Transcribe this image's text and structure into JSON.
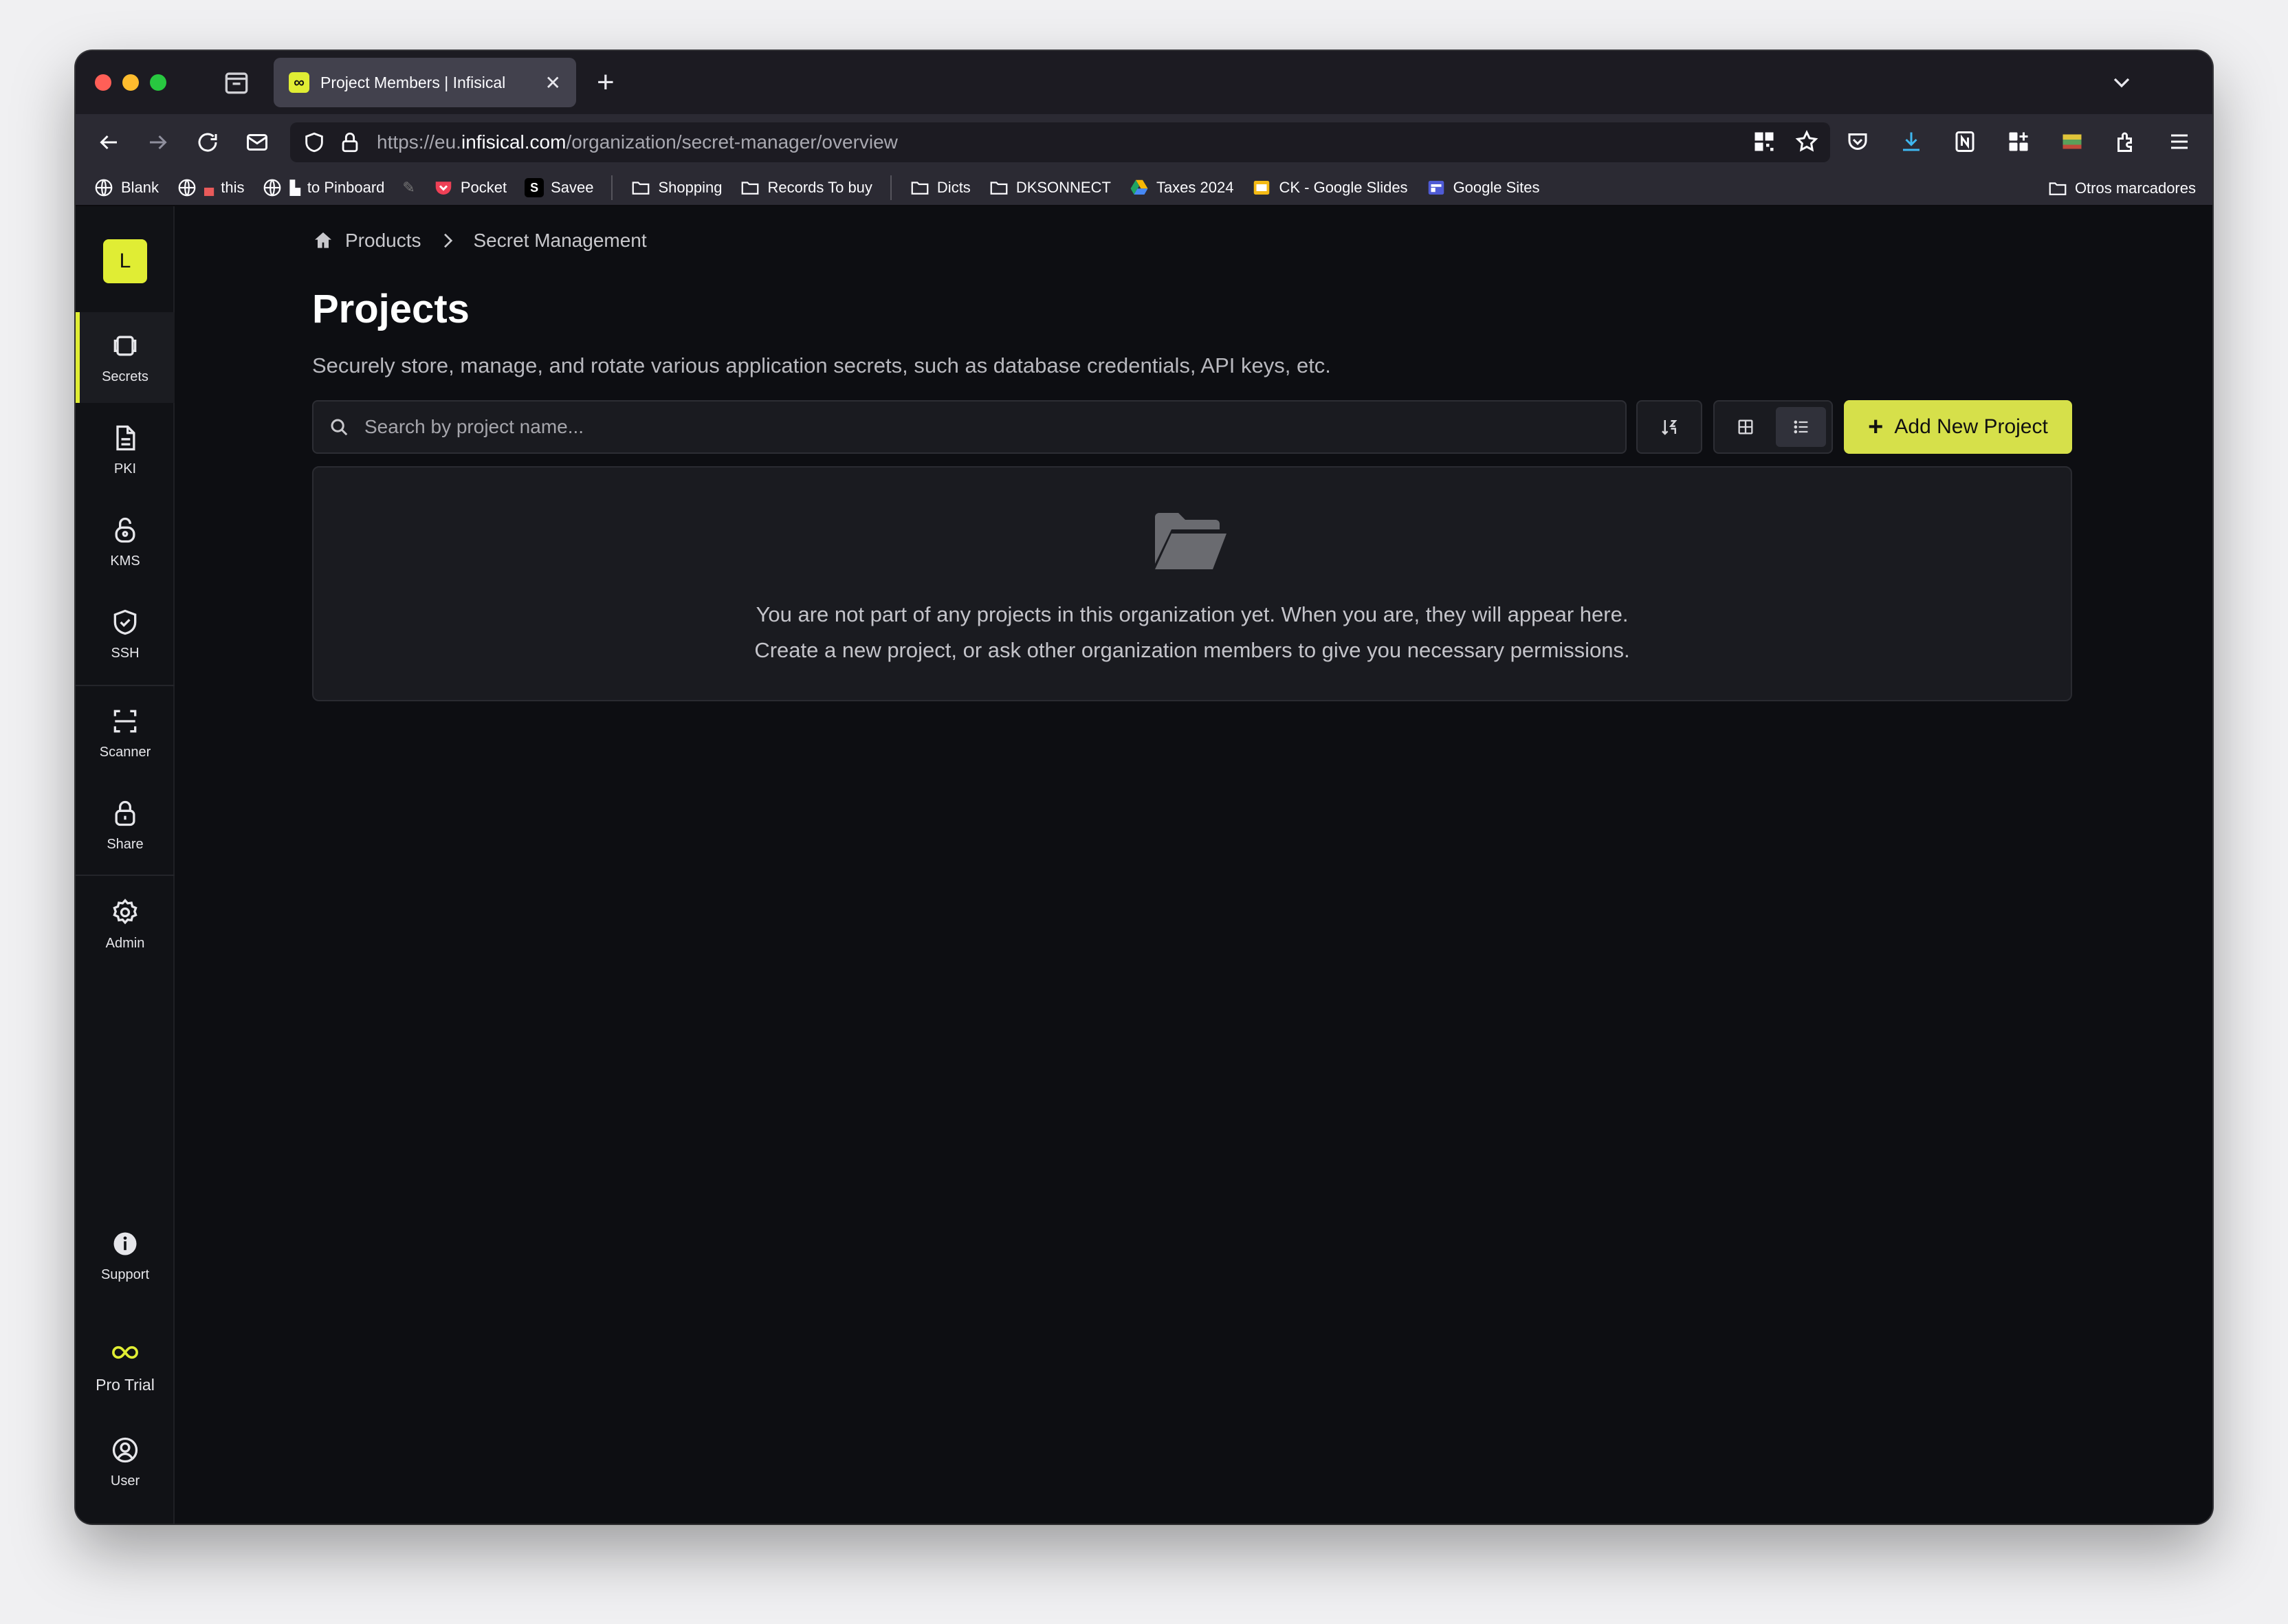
{
  "browser": {
    "tab_title": "Project Members | Infisical",
    "tab_favicon": "∞",
    "url_prefix": "https://eu.",
    "url_domain": "infisical.com",
    "url_path": "/organization/secret-manager/overview",
    "bookmarks": [
      {
        "label": "Blank",
        "icon": "globe-icon"
      },
      {
        "label": "this",
        "icon": "globe-icon"
      },
      {
        "label": "to Pinboard",
        "icon": "globe-icon"
      },
      {
        "label": "Pocket",
        "icon": "pocket-icon"
      },
      {
        "label": "Savee",
        "icon": "savee-icon",
        "badge": "S"
      },
      {
        "label": "Shopping",
        "icon": "folder-icon"
      },
      {
        "label": "Records To buy",
        "icon": "folder-icon"
      },
      {
        "label": "Dicts",
        "icon": "folder-icon"
      },
      {
        "label": "DKSONNECT",
        "icon": "folder-icon"
      },
      {
        "label": "Taxes 2024",
        "icon": "drive-icon"
      },
      {
        "label": "CK - Google Slides",
        "icon": "slides-icon"
      },
      {
        "label": "Google Sites",
        "icon": "sites-icon"
      }
    ],
    "other_bookmarks": "Otros marcadores"
  },
  "sidebar": {
    "org_initial": "L",
    "items": [
      {
        "label": "Secrets",
        "icon": "secrets-icon"
      },
      {
        "label": "PKI",
        "icon": "document-icon"
      },
      {
        "label": "KMS",
        "icon": "lock-open-icon"
      },
      {
        "label": "SSH",
        "icon": "shield-check-icon"
      },
      {
        "label": "Scanner",
        "icon": "scan-icon"
      },
      {
        "label": "Share",
        "icon": "lock-icon"
      },
      {
        "label": "Admin",
        "icon": "gear-icon"
      }
    ],
    "support_label": "Support",
    "pro_trial_label": "Pro Trial",
    "user_label": "User"
  },
  "breadcrumb": {
    "root": "Products",
    "current": "Secret Management"
  },
  "page": {
    "title": "Projects",
    "description": "Securely store, manage, and rotate various application secrets, such as database credentials, API keys, etc."
  },
  "toolbar": {
    "search_placeholder": "Search by project name...",
    "add_label": "Add New Project"
  },
  "empty_state": {
    "line1": "You are not part of any projects in this organization yet. When you are, they will appear here.",
    "line2": "Create a new project, or ask other organization members to give you necessary permissions."
  },
  "colors": {
    "accent": "#e0ed34",
    "background": "#0d0e12"
  }
}
